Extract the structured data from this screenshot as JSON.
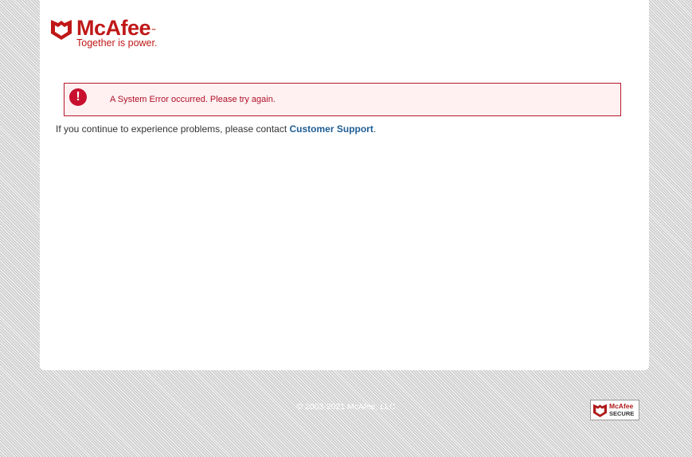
{
  "header": {
    "brand_name": "McAfee",
    "brand_tm": "™",
    "tagline": "Together is power."
  },
  "error": {
    "icon": "exclamation-icon",
    "icon_glyph": "!",
    "message": "A System Error occurred. Please try again."
  },
  "support": {
    "prefix": "If you continue to experience problems, please contact ",
    "link_label": "Customer Support",
    "suffix": "."
  },
  "footer": {
    "copyright": "© 2003-2021 McAfee, LLC",
    "badge_line1": "McAfee",
    "badge_line2": "SECURE"
  },
  "colors": {
    "brand_red": "#c01818",
    "error_border": "#b5192d",
    "error_bg": "#fff1f1",
    "link_blue": "#1f5d95"
  }
}
